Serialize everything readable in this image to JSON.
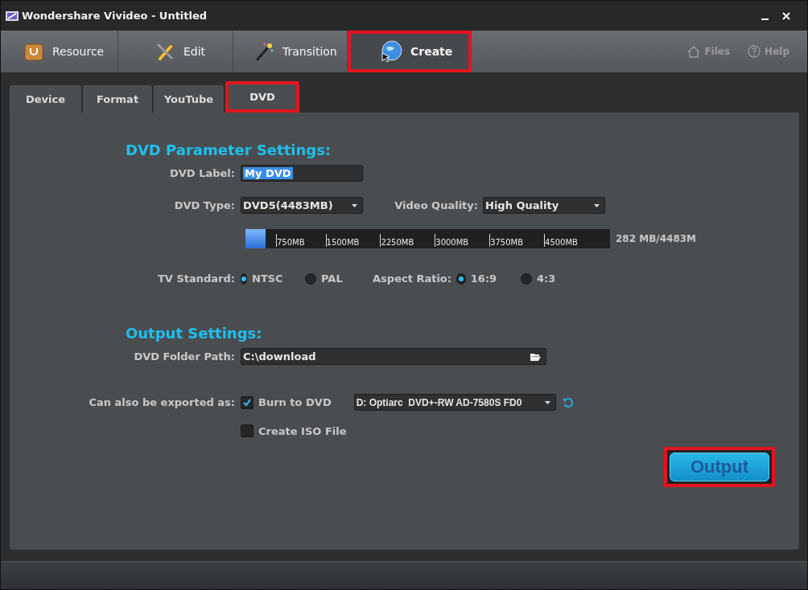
{
  "window": {
    "title": "Wondershare Vivideo - Untitled"
  },
  "main_tabs": [
    {
      "label": "Resource",
      "selected": false,
      "highlighted": false
    },
    {
      "label": "Edit",
      "selected": false,
      "highlighted": false
    },
    {
      "label": "Transition",
      "selected": false,
      "highlighted": false
    },
    {
      "label": "Create",
      "selected": true,
      "highlighted": true
    }
  ],
  "toolbar_links": [
    {
      "label": "Files"
    },
    {
      "label": "Help"
    }
  ],
  "sub_tabs": [
    {
      "label": "Device",
      "selected": false,
      "highlighted": false
    },
    {
      "label": "Format",
      "selected": false,
      "highlighted": false
    },
    {
      "label": "YouTube",
      "selected": false,
      "highlighted": false
    },
    {
      "label": "DVD",
      "selected": true,
      "highlighted": true
    }
  ],
  "dvd_parameters": {
    "heading": "DVD Parameter Settings:",
    "label_field": {
      "label": "DVD Label:",
      "value": "My DVD"
    },
    "dvd_type": {
      "label": "DVD Type:",
      "value": "DVD5(4483MB)"
    },
    "video_quality": {
      "label": "Video Quality:",
      "value": "High Quality"
    },
    "capacity": {
      "level": 0.055,
      "ticks": [
        "750MB",
        "1500MB",
        "2250MB",
        "3000MB",
        "3750MB",
        "4500MB"
      ],
      "reading": "282 MB/4483M"
    },
    "tv_standard": {
      "label": "TV Standard:",
      "options": [
        {
          "label": "NTSC",
          "selected": true
        },
        {
          "label": "PAL",
          "selected": false
        }
      ]
    },
    "aspect_ratio": {
      "label": "Aspect Ratio:",
      "options": [
        {
          "label": "16:9",
          "selected": true
        },
        {
          "label": "4:3",
          "selected": false
        }
      ]
    }
  },
  "output_settings": {
    "heading": "Output Settings:",
    "folder_path": {
      "label": "DVD Folder Path:",
      "value": "C:\\download"
    },
    "export_label": "Can also be exported as:",
    "burn_to_dvd": {
      "label": "Burn to DVD",
      "checked": true,
      "drive": "D: Optiarc  DVD+-RW AD-7580S FD0"
    },
    "create_iso": {
      "label": "Create ISO File",
      "checked": false
    }
  },
  "output_button": {
    "label": "Output",
    "highlighted": true
  }
}
